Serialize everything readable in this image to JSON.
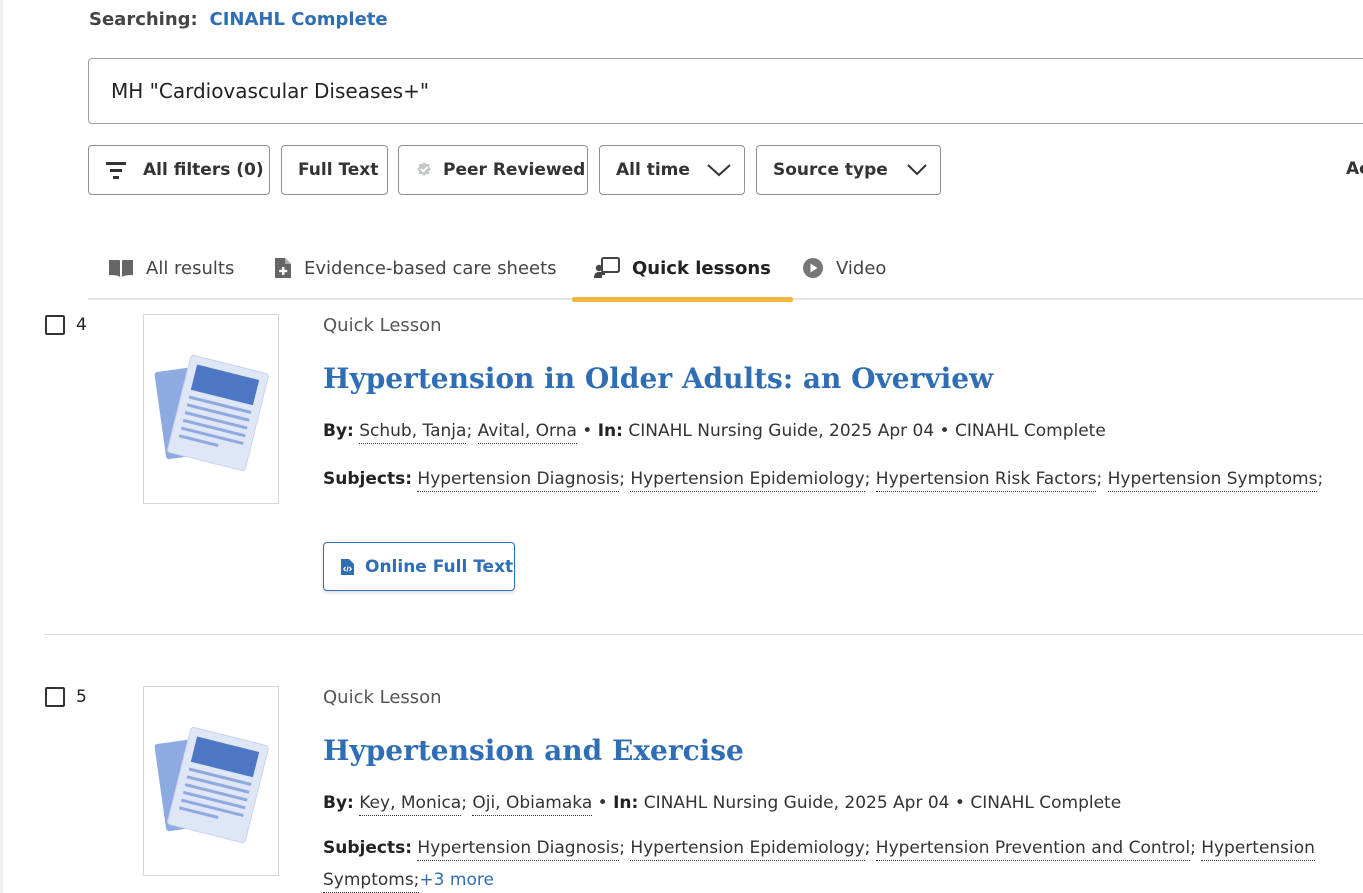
{
  "search": {
    "searching_label": "Searching:",
    "database": "CINAHL Complete",
    "query": "MH \"Cardiovascular Diseases+\""
  },
  "filters": {
    "all_filters": "All filters (0)",
    "full_text": "Full Text",
    "peer_reviewed": "Peer Reviewed",
    "all_time": "All time",
    "source_type": "Source type",
    "advanced_partial": "Ac"
  },
  "tabs": [
    {
      "label": "All results",
      "icon": "book-open-icon"
    },
    {
      "label": "Evidence-based care sheets",
      "icon": "document-plus-icon"
    },
    {
      "label": "Quick lessons",
      "icon": "presentation-icon",
      "active": true
    },
    {
      "label": "Video",
      "icon": "play-circle-icon"
    }
  ],
  "results": [
    {
      "number": "4",
      "doctype": "Quick Lesson",
      "title": "Hypertension in Older Adults: an Overview",
      "by_label": "By:",
      "authors": [
        "Schub, Tanja",
        "Avital, Orna"
      ],
      "in_label": "In:",
      "source": "CINAHL Nursing Guide, 2025 Apr 04",
      "database": "CINAHL Complete",
      "subjects_label": "Subjects:",
      "subjects": [
        "Hypertension Diagnosis",
        "Hypertension Epidemiology",
        "Hypertension Risk Factors",
        "Hypertension Symptoms"
      ],
      "button": "Online Full Text"
    },
    {
      "number": "5",
      "doctype": "Quick Lesson",
      "title": "Hypertension and Exercise",
      "by_label": "By:",
      "authors": [
        "Key, Monica",
        "Oji, Obiamaka"
      ],
      "in_label": "In:",
      "source": "CINAHL Nursing Guide, 2025 Apr 04",
      "database": "CINAHL Complete",
      "subjects_label": "Subjects:",
      "subjects": [
        "Hypertension Diagnosis",
        "Hypertension Epidemiology",
        "Hypertension Prevention and Control",
        "Hypertension"
      ],
      "subjects_continued": "Symptoms;",
      "more": "+3 more"
    }
  ],
  "separators": {
    "semicolon": ";",
    "bullet": "•"
  },
  "colors": {
    "link": "#2f6db5",
    "active_tab": "#f4b740"
  }
}
